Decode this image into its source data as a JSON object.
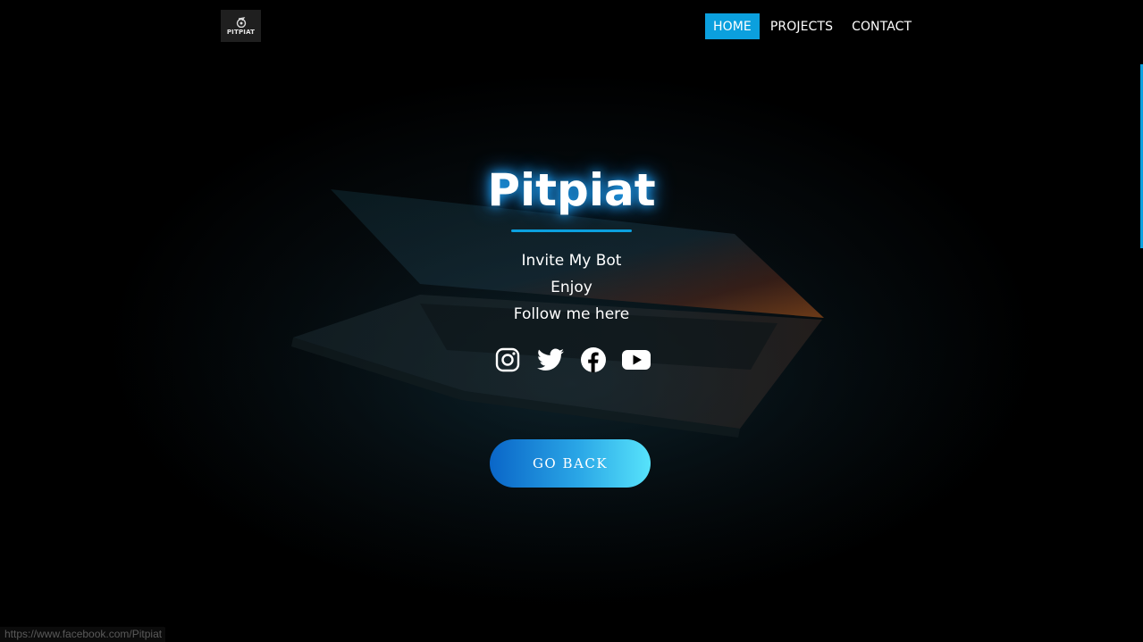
{
  "header": {
    "logo_text": "PITPIAT",
    "nav": [
      {
        "label": "HOME",
        "active": true
      },
      {
        "label": "PROJECTS",
        "active": false
      },
      {
        "label": "CONTACT",
        "active": false
      }
    ]
  },
  "hero": {
    "title": "Pitpiat",
    "lines": [
      "Invite My Bot",
      "Enjoy",
      "Follow me here"
    ],
    "socials": [
      {
        "icon": "instagram-icon"
      },
      {
        "icon": "twitter-icon"
      },
      {
        "icon": "facebook-icon"
      },
      {
        "icon": "youtube-icon"
      }
    ],
    "button_label": "GO BACK"
  },
  "status_bar": {
    "url": "https://www.facebook.com/Pitpiat"
  },
  "colors": {
    "accent": "#0ba0de",
    "button_gradient_start": "#0a66c8",
    "button_gradient_end": "#57e3fb",
    "background": "#000000"
  }
}
